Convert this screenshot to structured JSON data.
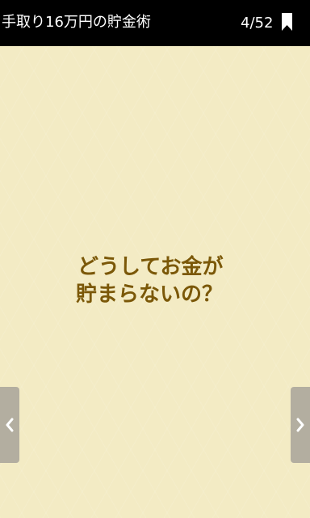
{
  "header": {
    "title": "手取り16万円の貯金術",
    "page_counter": "4/52",
    "bookmark_icon": "bookmark-icon"
  },
  "content": {
    "line1": "どうしてお金が",
    "line2": "貯まらないの？"
  },
  "navigation": {
    "prev_icon": "chevron-left-icon",
    "next_icon": "chevron-right-icon"
  },
  "colors": {
    "header_bg": "#000000",
    "page_bg": "#f3ebc4",
    "text_accent": "#7b5808",
    "nav_button": "#b3aea0"
  }
}
